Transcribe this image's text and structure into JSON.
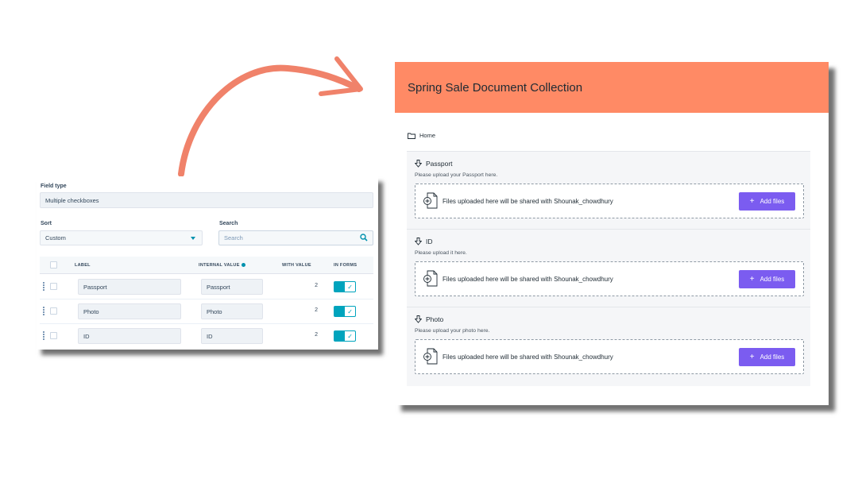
{
  "left_panel": {
    "field_type_label": "Field type",
    "field_type_value": "Multiple checkboxes",
    "sort_label": "Sort",
    "sort_value": "Custom",
    "search_label": "Search",
    "search_placeholder": "Search",
    "columns": [
      "LABEL",
      "INTERNAL VALUE",
      "WITH VALUE",
      "IN FORMS"
    ],
    "rows": [
      {
        "label": "Passport",
        "internal_value": "Passport",
        "with_value": "2",
        "in_forms": true
      },
      {
        "label": "Photo",
        "internal_value": "Photo",
        "with_value": "2",
        "in_forms": true
      },
      {
        "label": "ID",
        "internal_value": "ID",
        "with_value": "2",
        "in_forms": true
      }
    ],
    "accent_color": "#00a4bd"
  },
  "right_panel": {
    "title": "Spring Sale Document Collection",
    "header_color": "#ff8a65",
    "breadcrumb": "Home",
    "sections": [
      {
        "title": "Passport",
        "description": "Please upload your Passport here.",
        "dropzone_text": "Files uploaded here will be shared with Shounak_chowdhury",
        "button_label": "Add files"
      },
      {
        "title": "ID",
        "description": "Please upload it here.",
        "dropzone_text": "Files uploaded here will be shared with Shounak_chowdhury",
        "button_label": "Add files"
      },
      {
        "title": "Photo",
        "description": "Please upload your photo here.",
        "dropzone_text": "Files uploaded here will be shared with Shounak_chowdhury",
        "button_label": "Add files"
      }
    ],
    "button_color": "#7b5cf0"
  },
  "arrow_color": "#f0826a"
}
